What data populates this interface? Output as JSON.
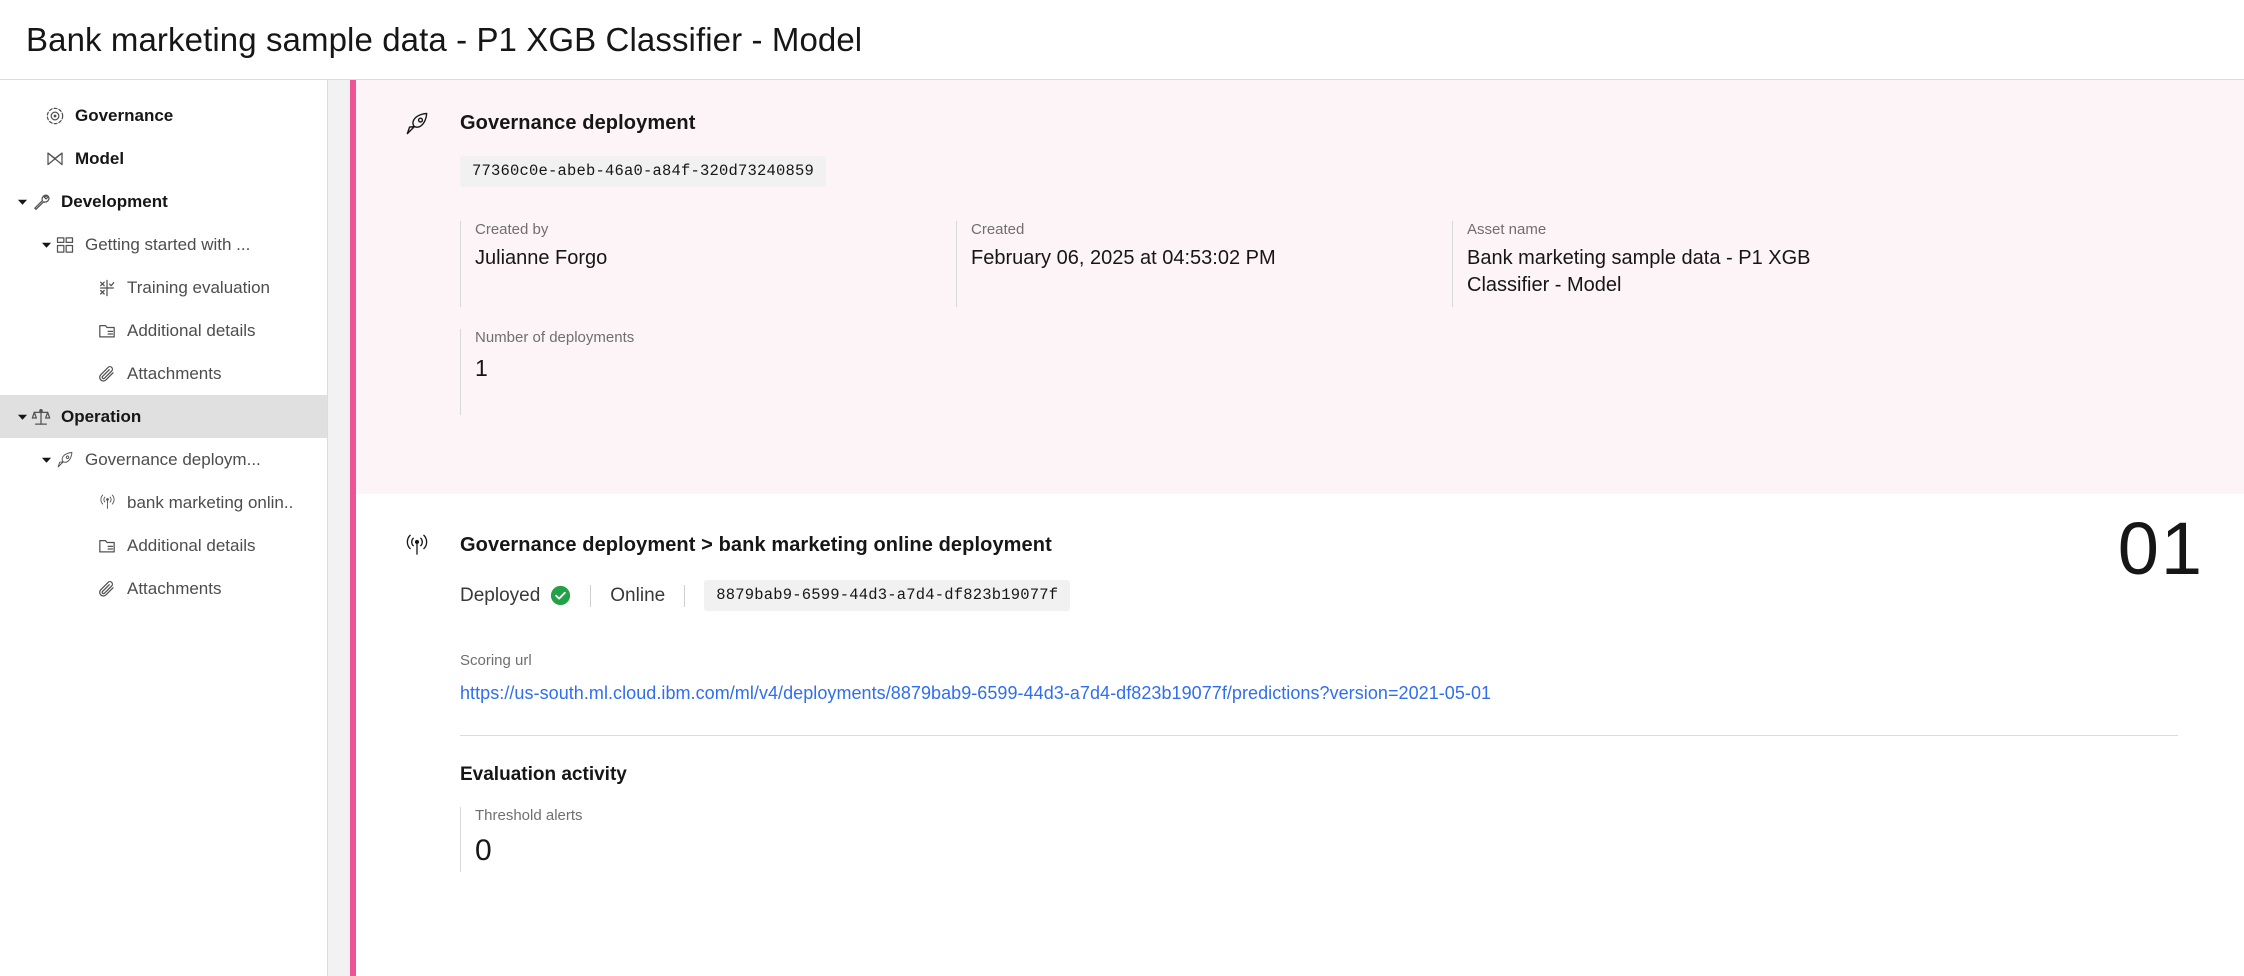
{
  "header": {
    "title": "Bank marketing sample data - P1 XGB Classifier - Model"
  },
  "sidebar": {
    "items": [
      {
        "label": "Governance",
        "icon": "governance-icon",
        "level": 0,
        "caret": "none",
        "selected": false
      },
      {
        "label": "Model",
        "icon": "model-icon",
        "level": 0,
        "caret": "none",
        "selected": false
      },
      {
        "label": "Development",
        "icon": "wrench-icon",
        "level": 0,
        "caret": "expanded",
        "selected": false
      },
      {
        "label": "Getting started with ...",
        "icon": "dashboard-icon",
        "level": 1,
        "caret": "expanded",
        "selected": false
      },
      {
        "label": "Training evaluation",
        "icon": "evaluation-icon",
        "level": 2,
        "caret": "none",
        "selected": false
      },
      {
        "label": "Additional details",
        "icon": "document-icon",
        "level": 2,
        "caret": "none",
        "selected": false
      },
      {
        "label": "Attachments",
        "icon": "paperclip-icon",
        "level": 2,
        "caret": "none",
        "selected": false
      },
      {
        "label": "Operation",
        "icon": "scales-icon",
        "level": 0,
        "caret": "expanded",
        "selected": true
      },
      {
        "label": "Governance deploym...",
        "icon": "rocket-icon",
        "level": 1,
        "caret": "expanded",
        "selected": false
      },
      {
        "label": "bank marketing onlin..",
        "icon": "broadcast-icon",
        "level": 2,
        "caret": "none",
        "selected": false
      },
      {
        "label": "Additional details",
        "icon": "document-icon",
        "level": 2,
        "caret": "none",
        "selected": false
      },
      {
        "label": "Attachments",
        "icon": "paperclip-icon",
        "level": 2,
        "caret": "none",
        "selected": false
      }
    ]
  },
  "governance_deployment": {
    "title": "Governance deployment",
    "uuid": "77360c0e-abeb-46a0-a84f-320d73240859",
    "fields": {
      "created_by_label": "Created by",
      "created_by_value": "Julianne Forgo",
      "created_label": "Created",
      "created_value": "February 06, 2025 at 04:53:02 PM",
      "asset_name_label": "Asset name",
      "asset_name_value": "Bank marketing sample data - P1 XGB Classifier - Model",
      "deployments_label": "Number of deployments",
      "deployments_value": "1"
    }
  },
  "online_deployment": {
    "title": "Governance deployment > bank marketing online deployment",
    "index_number": "01",
    "status": "Deployed",
    "connectivity": "Online",
    "uuid": "8879bab9-6599-44d3-a7d4-df823b19077f",
    "scoring_url_label": "Scoring url",
    "scoring_url": "https://us-south.ml.cloud.ibm.com/ml/v4/deployments/8879bab9-6599-44d3-a7d4-df823b19077f/predictions?version=2021-05-01",
    "evaluation_title": "Evaluation activity",
    "threshold_alerts_label": "Threshold alerts",
    "threshold_alerts_value": "0"
  },
  "colors": {
    "accent_bar": "#ee5396",
    "tinted_section": "#fdf4f8",
    "link": "#2f6ef0",
    "status_ok": "#24a148",
    "selected_nav": "#e0e0e0"
  }
}
